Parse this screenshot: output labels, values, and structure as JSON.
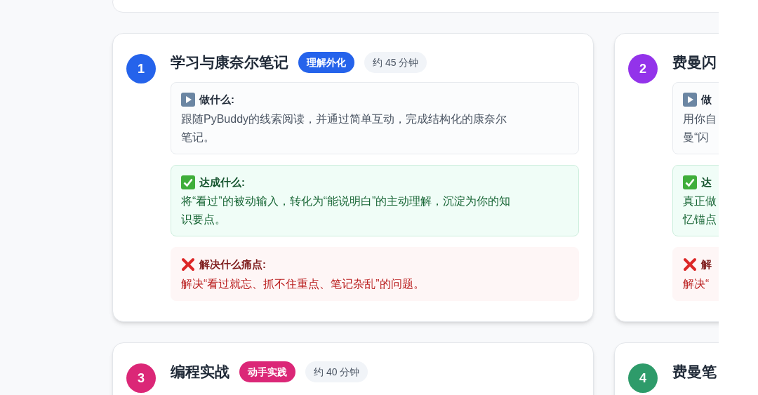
{
  "cards": [
    {
      "number": "1",
      "color": "#2563eb",
      "title": "学习与康奈尔笔记",
      "tag": "理解外化",
      "duration": "约 45 分钟",
      "sections": [
        {
          "kind": "do",
          "label": "做什么:",
          "lines": [
            "跟随PyBuddy的线索阅读，并通过简单互动，完成结构化的康奈尔",
            "笔记。"
          ]
        },
        {
          "kind": "achieve",
          "label": "达成什么:",
          "lines": [
            "将“看过”的被动输入，转化为“能说明白”的主动理解，沉淀为你的知",
            "识要点。"
          ]
        },
        {
          "kind": "pain",
          "label": "解决什么痛点:",
          "lines": [
            "解决“看过就忘、抓不住重点、笔记杂乱”的问题。"
          ]
        }
      ]
    },
    {
      "number": "2",
      "color": "#9333ea",
      "title": "费曼闪",
      "sections": [
        {
          "kind": "do",
          "label": "做",
          "lines": [
            "用你自",
            "曼“闪"
          ]
        },
        {
          "kind": "achieve",
          "label": "达",
          "lines": [
            "真正做",
            "忆锚点"
          ]
        },
        {
          "kind": "pain",
          "label": "解",
          "lines": [
            "解决“"
          ]
        }
      ]
    },
    {
      "number": "3",
      "color": "#db2777",
      "title": "编程实战",
      "tag": "动手实践",
      "duration": "约 40 分钟"
    },
    {
      "number": "4",
      "color": "#2e9b6a",
      "title": "费曼笔"
    }
  ]
}
